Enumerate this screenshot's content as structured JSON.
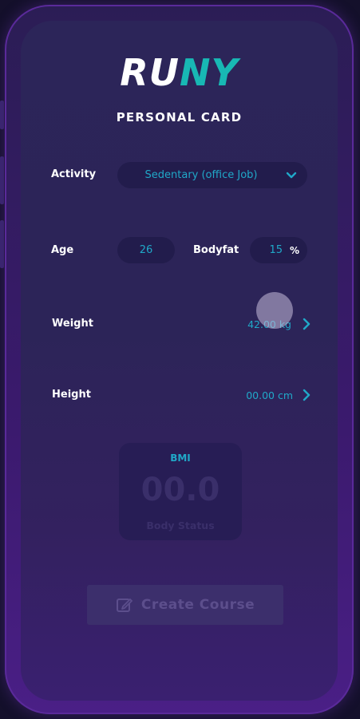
{
  "app": {
    "logo_part1": "RU",
    "logo_part2": "NY"
  },
  "page": {
    "title": "PERSONAL CARD"
  },
  "form": {
    "activity": {
      "label": "Activity",
      "value": "Sedentary (office Job)"
    },
    "age": {
      "label": "Age",
      "value": "26"
    },
    "bodyfat": {
      "label": "Bodyfat",
      "value": "15",
      "unit": "%"
    },
    "weight": {
      "label": "Weight",
      "value": "42.00 kg"
    },
    "height": {
      "label": "Height",
      "value": "00.00 cm"
    }
  },
  "bmi": {
    "label": "BMI",
    "value": "00.0",
    "status": "Body Status"
  },
  "actions": {
    "create_course": "Create Course"
  },
  "colors": {
    "accent": "#20a8c8",
    "brand_teal": "#18b8b4",
    "background": "#2c2559"
  },
  "icons": {
    "dropdown": "chevron-down-icon",
    "next": "chevron-right-icon",
    "edit": "edit-icon"
  }
}
